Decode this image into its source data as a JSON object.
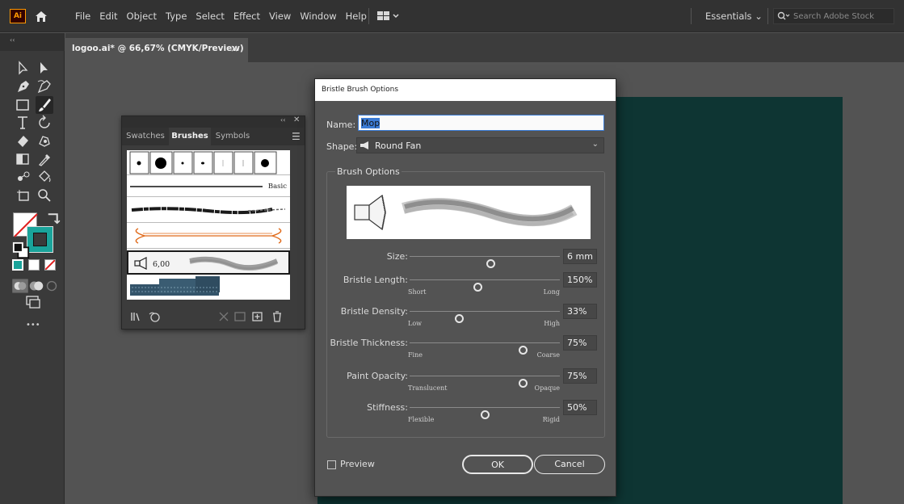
{
  "app": {
    "logo_text": "Ai",
    "menus": [
      "File",
      "Edit",
      "Object",
      "Type",
      "Select",
      "Effect",
      "View",
      "Window",
      "Help"
    ],
    "workspace": "Essentials ⌄",
    "stock_search_placeholder": "Search Adobe Stock"
  },
  "document": {
    "tab_title": "logoo.ai* @ 66,67% (CMYK/Preview)",
    "close_glyph": "×"
  },
  "toolbar": {
    "grip_label": "‹‹",
    "more_glyph": "•••"
  },
  "brushes_panel": {
    "collapse_glyph": "‹‹",
    "close_glyph": "✕",
    "tabs": [
      "Swatches",
      "Brushes",
      "Symbols"
    ],
    "active_tab": "Brushes",
    "basic_label": "Basic",
    "selected_brush_size": "6,00"
  },
  "dialog": {
    "title": "Bristle Brush Options",
    "name_label": "Name:",
    "name_value": "Mop",
    "shape_label": "Shape:",
    "shape_value": "Round Fan",
    "options_legend": "Brush Options",
    "sliders": [
      {
        "label": "Size:",
        "value": "6 mm",
        "position": 0.54,
        "min": "",
        "max": ""
      },
      {
        "label": "Bristle Length:",
        "value": "150%",
        "position": 0.45,
        "min": "Short",
        "max": "Long"
      },
      {
        "label": "Bristle Density:",
        "value": "33%",
        "position": 0.33,
        "min": "Low",
        "max": "High"
      },
      {
        "label": "Bristle Thickness:",
        "value": "75%",
        "position": 0.75,
        "min": "Fine",
        "max": "Coarse"
      },
      {
        "label": "Paint Opacity:",
        "value": "75%",
        "position": 0.75,
        "min": "Translucent",
        "max": "Opaque"
      },
      {
        "label": "Stiffness:",
        "value": "50%",
        "position": 0.5,
        "min": "Flexible",
        "max": "Rigid"
      }
    ],
    "preview_label": "Preview",
    "ok_label": "OK",
    "cancel_label": "Cancel"
  },
  "colors": {
    "artboard": "#0e3533",
    "fill_swatch": "#1aa39a",
    "accent_brush": "#e06a1a"
  }
}
